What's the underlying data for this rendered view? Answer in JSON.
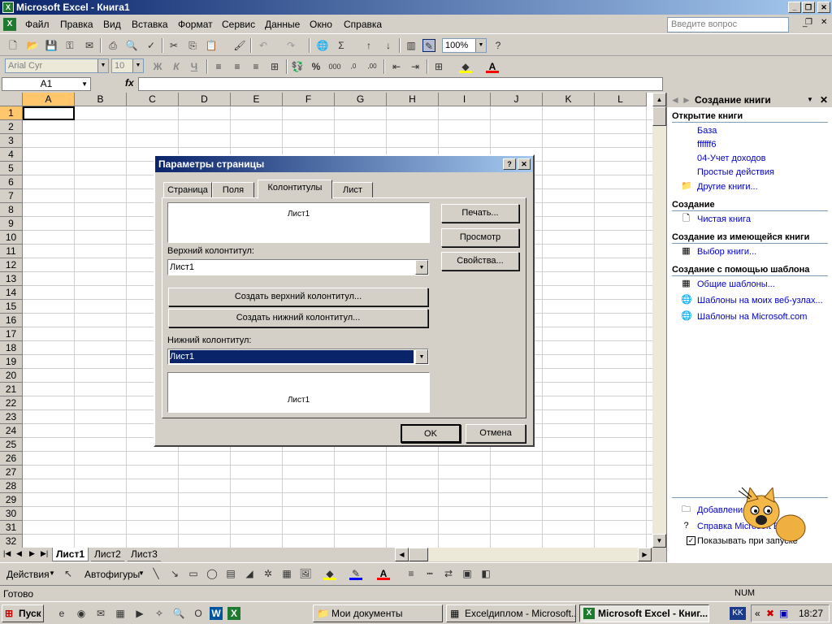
{
  "window": {
    "title": "Microsoft Excel - Книга1",
    "app_icon": "X"
  },
  "menu": [
    "Файл",
    "Правка",
    "Вид",
    "Вставка",
    "Формат",
    "Сервис",
    "Данные",
    "Окно",
    "Справка"
  ],
  "question_placeholder": "Введите вопрос",
  "toolbar": {
    "zoom": "100%",
    "font_name": "Arial Cyr",
    "font_size": "10",
    "bold": "Ж",
    "italic": "К",
    "underline": "Ч"
  },
  "formula_bar": {
    "name_box": "A1",
    "fx": "fx",
    "value": ""
  },
  "columns": [
    "A",
    "B",
    "C",
    "D",
    "E",
    "F",
    "G",
    "H",
    "I",
    "J",
    "K",
    "L"
  ],
  "rows": [
    "1",
    "2",
    "3",
    "4",
    "5",
    "6",
    "7",
    "8",
    "9",
    "10",
    "11",
    "12",
    "13",
    "14",
    "15",
    "16",
    "17",
    "18",
    "19",
    "20",
    "21",
    "22",
    "23",
    "24",
    "25",
    "26",
    "27",
    "28",
    "29",
    "30",
    "31",
    "32"
  ],
  "sheets": [
    "Лист1",
    "Лист2",
    "Лист3"
  ],
  "task_pane": {
    "title": "Создание книги",
    "open_heading": "Открытие книги",
    "open_items": [
      "База",
      "ffffff6",
      "04-Учет доходов",
      "Простые действия",
      "Другие книги..."
    ],
    "create_heading": "Создание",
    "create_items": [
      "Чистая книга"
    ],
    "existing_heading": "Создание из имеющейся книги",
    "existing_items": [
      "Выбор книги..."
    ],
    "template_heading": "Создание с помощью шаблона",
    "template_items": [
      "Общие шаблоны...",
      "Шаблоны на моих веб-узлах...",
      "Шаблоны на Microsoft.com"
    ],
    "bottom_add": "Добавление у",
    "bottom_help": "Справка Microsoft Excel",
    "bottom_show": "Показывать при запуске"
  },
  "dialog": {
    "title": "Параметры страницы",
    "help": "?",
    "close": "✕",
    "tabs": [
      "Страница",
      "Поля",
      "Колонтитулы",
      "Лист"
    ],
    "active_tab": "Колонтитулы",
    "header_preview": "Лист1",
    "header_label": "Верхний колонтитул:",
    "header_value": "Лист1",
    "create_header_btn": "Создать верхний колонтитул...",
    "create_footer_btn": "Создать нижний колонтитул...",
    "footer_label": "Нижний колонтитул:",
    "footer_value": "Лист1",
    "footer_preview": "Лист1",
    "print_btn": "Печать...",
    "preview_btn": "Просмотр",
    "props_btn": "Свойства...",
    "ok_btn": "OK",
    "cancel_btn": "Отмена"
  },
  "drawing": {
    "actions": "Действия",
    "autoshapes": "Автофигуры"
  },
  "status": {
    "ready": "Готово",
    "num": "NUM"
  },
  "taskbar": {
    "start": "Пуск",
    "tasks": [
      "Мои документы",
      "Excelдиплом - Microsoft...",
      "Microsoft Excel - Книг..."
    ],
    "lang": "KK",
    "time": "18:27"
  }
}
